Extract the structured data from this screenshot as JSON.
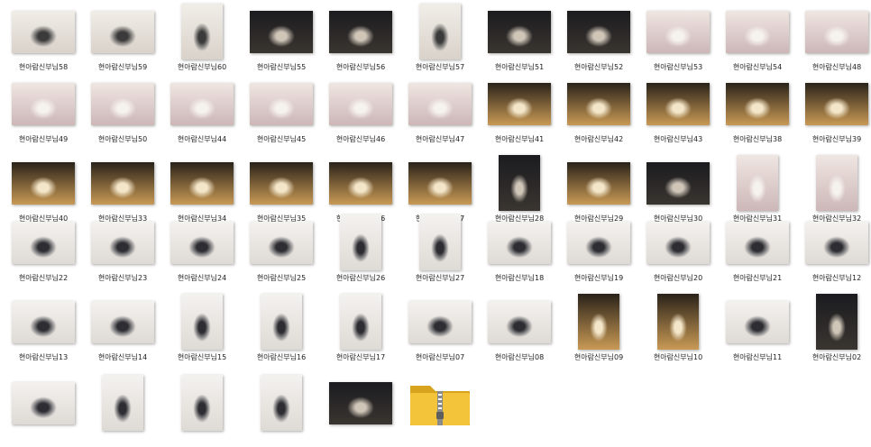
{
  "files": [
    {
      "name": "현아람신부님58",
      "orient": "L",
      "tone": "bright"
    },
    {
      "name": "현아람신부님59",
      "orient": "L",
      "tone": "bright"
    },
    {
      "name": "현아람신부님60",
      "orient": "P",
      "tone": "bright"
    },
    {
      "name": "현아람신부님55",
      "orient": "L",
      "tone": "dark"
    },
    {
      "name": "현아람신부님56",
      "orient": "L",
      "tone": "dark"
    },
    {
      "name": "현아람신부님57",
      "orient": "P",
      "tone": "bright"
    },
    {
      "name": "현아람신부님51",
      "orient": "L",
      "tone": "dark"
    },
    {
      "name": "현아람신부님52",
      "orient": "L",
      "tone": "dark"
    },
    {
      "name": "현아람신부님53",
      "orient": "L",
      "tone": "floral"
    },
    {
      "name": "현아람신부님54",
      "orient": "L",
      "tone": "floral"
    },
    {
      "name": "현아람신부님48",
      "orient": "L",
      "tone": "floral"
    },
    {
      "name": "현아람신부님49",
      "orient": "L",
      "tone": "floral"
    },
    {
      "name": "현아람신부님50",
      "orient": "L",
      "tone": "floral"
    },
    {
      "name": "현아람신부님44",
      "orient": "L",
      "tone": "floral"
    },
    {
      "name": "현아람신부님45",
      "orient": "L",
      "tone": "floral"
    },
    {
      "name": "현아람신부님46",
      "orient": "L",
      "tone": "floral"
    },
    {
      "name": "현아람신부님47",
      "orient": "L",
      "tone": "floral"
    },
    {
      "name": "현아람신부님41",
      "orient": "L",
      "tone": "warm"
    },
    {
      "name": "현아람신부님42",
      "orient": "L",
      "tone": "warm"
    },
    {
      "name": "현아람신부님43",
      "orient": "L",
      "tone": "warm"
    },
    {
      "name": "현아람신부님38",
      "orient": "L",
      "tone": "warm"
    },
    {
      "name": "현아람신부님39",
      "orient": "L",
      "tone": "warm"
    },
    {
      "name": "현아람신부님40",
      "orient": "L",
      "tone": "warm"
    },
    {
      "name": "현아람신부님33",
      "orient": "L",
      "tone": "warm"
    },
    {
      "name": "현아람신부님34",
      "orient": "L",
      "tone": "warm"
    },
    {
      "name": "현아람신부님35",
      "orient": "L",
      "tone": "warm"
    },
    {
      "name": "현아람신부님36",
      "orient": "L",
      "tone": "warm"
    },
    {
      "name": "현아람신부님37",
      "orient": "L",
      "tone": "warm"
    },
    {
      "name": "현아람신부님28",
      "orient": "P",
      "tone": "dark"
    },
    {
      "name": "현아람신부님29",
      "orient": "L",
      "tone": "warm"
    },
    {
      "name": "현아람신부님30",
      "orient": "L",
      "tone": "dark"
    },
    {
      "name": "현아람신부님31",
      "orient": "P",
      "tone": "floral"
    },
    {
      "name": "현아람신부님32",
      "orient": "P",
      "tone": "floral"
    },
    {
      "name": "현아람신부님22",
      "orient": "L",
      "tone": "studio"
    },
    {
      "name": "현아람신부님23",
      "orient": "L",
      "tone": "studio"
    },
    {
      "name": "현아람신부님24",
      "orient": "L",
      "tone": "studio"
    },
    {
      "name": "현아람신부님25",
      "orient": "L",
      "tone": "studio"
    },
    {
      "name": "현아람신부님26",
      "orient": "P",
      "tone": "studio"
    },
    {
      "name": "현아람신부님27",
      "orient": "P",
      "tone": "studio"
    },
    {
      "name": "현아람신부님18",
      "orient": "L",
      "tone": "studio"
    },
    {
      "name": "현아람신부님19",
      "orient": "L",
      "tone": "studio"
    },
    {
      "name": "현아람신부님20",
      "orient": "L",
      "tone": "studio"
    },
    {
      "name": "현아람신부님21",
      "orient": "L",
      "tone": "studio"
    },
    {
      "name": "현아람신부님12",
      "orient": "L",
      "tone": "studio"
    },
    {
      "name": "현아람신부님13",
      "orient": "L",
      "tone": "studio"
    },
    {
      "name": "현아람신부님14",
      "orient": "L",
      "tone": "studio"
    },
    {
      "name": "현아람신부님15",
      "orient": "P",
      "tone": "studio"
    },
    {
      "name": "현아람신부님16",
      "orient": "P",
      "tone": "studio"
    },
    {
      "name": "현아람신부님17",
      "orient": "P",
      "tone": "studio"
    },
    {
      "name": "현아람신부님07",
      "orient": "L",
      "tone": "studio"
    },
    {
      "name": "현아람신부님08",
      "orient": "L",
      "tone": "studio"
    },
    {
      "name": "현아람신부님09",
      "orient": "P",
      "tone": "warm"
    },
    {
      "name": "현아람신부님10",
      "orient": "P",
      "tone": "warm"
    },
    {
      "name": "현아람신부님11",
      "orient": "L",
      "tone": "studio"
    },
    {
      "name": "현아람신부님02",
      "orient": "P",
      "tone": "dark"
    },
    {
      "name": "",
      "orient": "L",
      "tone": "studio"
    },
    {
      "name": "",
      "orient": "P",
      "tone": "studio"
    },
    {
      "name": "",
      "orient": "P",
      "tone": "studio"
    },
    {
      "name": "",
      "orient": "P",
      "tone": "studio"
    },
    {
      "name": "",
      "orient": "L",
      "tone": "dark"
    },
    {
      "name": "",
      "orient": "ZIP",
      "tone": "zip"
    }
  ],
  "icons": {
    "zip": "zip-folder-icon"
  },
  "colors": {
    "folder": "#f3c33a",
    "folder_dark": "#d9a41d",
    "zipper": "#8a8a8a"
  }
}
